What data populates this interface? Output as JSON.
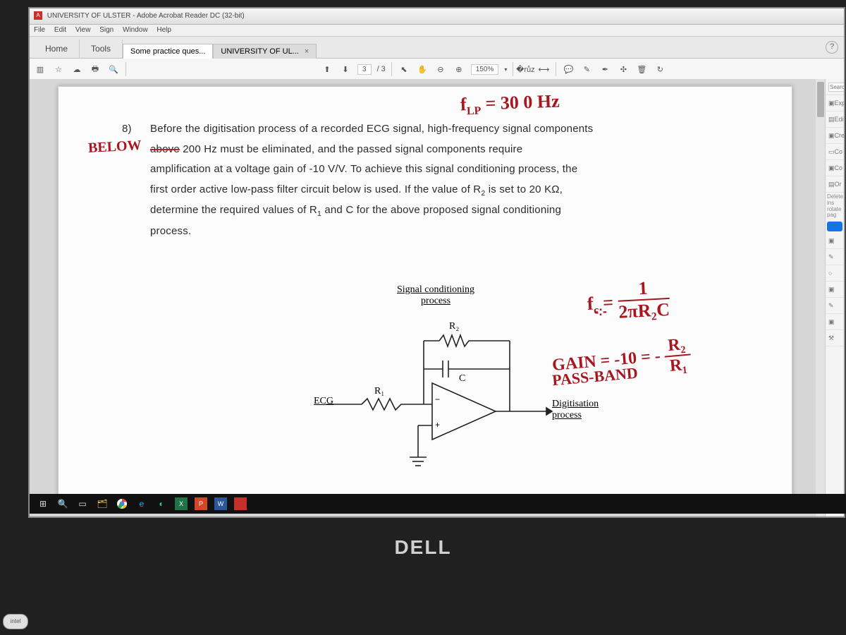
{
  "window": {
    "title": "UNIVERSITY OF ULSTER - Adobe Acrobat Reader DC (32-bit)"
  },
  "menu": {
    "items": [
      "File",
      "Edit",
      "View",
      "Sign",
      "Window",
      "Help"
    ]
  },
  "tabs": {
    "home": "Home",
    "tools": "Tools",
    "doc1": "Some practice ques...",
    "doc2": "UNIVERSITY OF UL..."
  },
  "toolbar": {
    "page_current": "3",
    "page_total": "/ 3",
    "zoom": "150%"
  },
  "sidepanel": {
    "search_placeholder": "Search 'C",
    "items": [
      "Exp",
      "Edi",
      "Cre",
      "Co",
      "Co",
      "Or"
    ],
    "deletetip": "Delete, ins\nrotate pag"
  },
  "question": {
    "num": "8)",
    "line1_a": "Before the digitisation process of a recorded ECG signal, high-frequency signal components",
    "line2_a": "above",
    "line2_b": " 200 Hz must be eliminated, and the passed signal components require",
    "line3": "amplification at a voltage gain of -10 V/V. To achieve this signal conditioning process, the",
    "line4_a": "first order active low-pass filter circuit below is used. If the value of R",
    "line4_b": " is set to 20 KΩ,",
    "line5_a": "determine the required values of R",
    "line5_b": " and C for the above proposed signal conditioning",
    "line6": "process."
  },
  "circuit": {
    "title": "Signal conditioning",
    "subtitle": "process",
    "in": "ECG",
    "r1": "R₁",
    "r2": "R₂",
    "c": "C",
    "plus": "+",
    "minus": "−",
    "out1": "Digitisation",
    "out2": "process"
  },
  "annotations": {
    "below": "BELOW",
    "flp": "f",
    "flp_sub": "LP",
    "flp_eq": " = 30 0 Hz",
    "fc1": "f",
    "fc1_sub": "c",
    "fc1_eq": " = ",
    "fc_num": "1",
    "fc_den": "2πR₂C",
    "gain": "GAIN = -10 = - ",
    "gain_num": "R₂",
    "gain_den": "R₁",
    "passband": "PASS-BAND"
  },
  "brand": "DELL",
  "intel": "intel"
}
